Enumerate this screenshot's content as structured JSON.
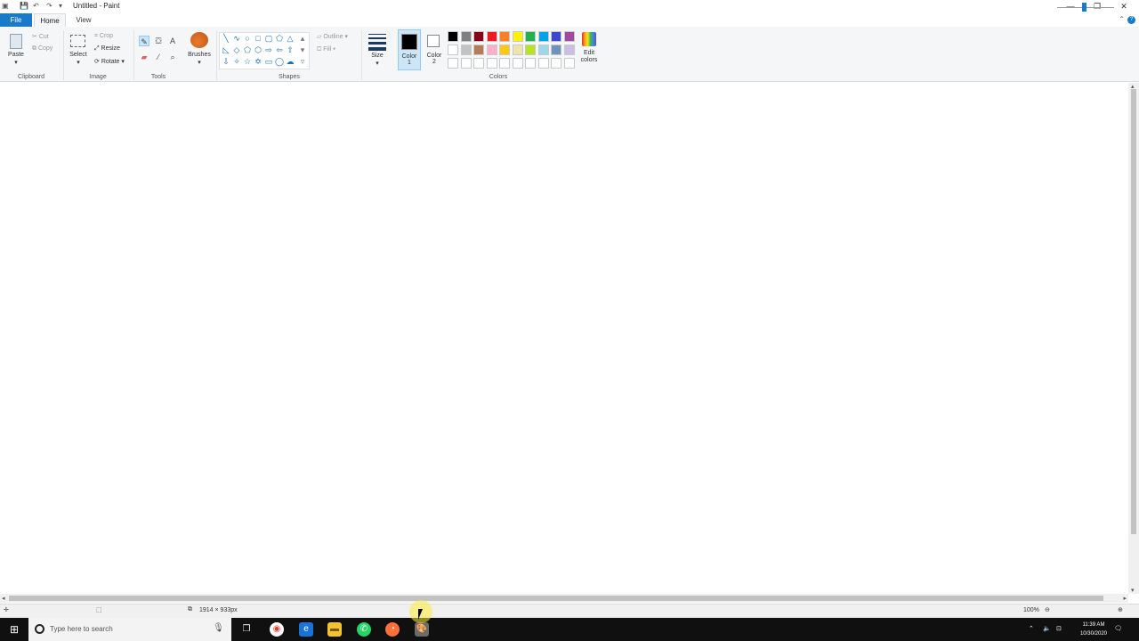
{
  "window": {
    "title": "Untitled - Paint",
    "minimize": "—",
    "restore": "❐",
    "close": "✕"
  },
  "quick_access": {
    "save_icon": "save-icon",
    "undo_icon": "undo-icon",
    "redo_icon": "redo-icon"
  },
  "tabs": [
    {
      "label": "File"
    },
    {
      "label": "Home"
    },
    {
      "label": "View"
    }
  ],
  "ribbon": {
    "clipboard": {
      "paste": "Paste",
      "cut": "Cut",
      "copy": "Copy",
      "group": "Clipboard"
    },
    "image": {
      "select": "Select",
      "crop": "Crop",
      "resize": "Resize",
      "rotate": "Rotate",
      "group": "Image"
    },
    "tools": {
      "group": "Tools",
      "text_tool": "A"
    },
    "brushes": {
      "label": "Brushes"
    },
    "shapes": {
      "group": "Shapes",
      "outline": "Outline",
      "fill": "Fill"
    },
    "size": {
      "label": "Size"
    },
    "color1": {
      "label1": "Color",
      "label2": "1",
      "value": "#000000"
    },
    "color2": {
      "label1": "Color",
      "label2": "2",
      "value": "#ffffff"
    },
    "colors_group": "Colors",
    "edit_colors": {
      "line1": "Edit",
      "line2": "colors"
    },
    "palette_row1": [
      "#000000",
      "#7f7f7f",
      "#880015",
      "#ed1c24",
      "#ff7f27",
      "#fff200",
      "#22b14c",
      "#00a2e8",
      "#3f48cc",
      "#a349a4"
    ],
    "palette_row2": [
      "#ffffff",
      "#c3c3c3",
      "#b97a57",
      "#ffaec9",
      "#ffc90e",
      "#efe4b0",
      "#b5e61d",
      "#99d9ea",
      "#7092be",
      "#c8bfe7"
    ]
  },
  "status": {
    "canvas_size": "1914 × 933px",
    "zoom": "100%"
  },
  "taskbar": {
    "search_placeholder": "Type here to search",
    "time": "11:39 AM",
    "date": "10/30/2020"
  }
}
